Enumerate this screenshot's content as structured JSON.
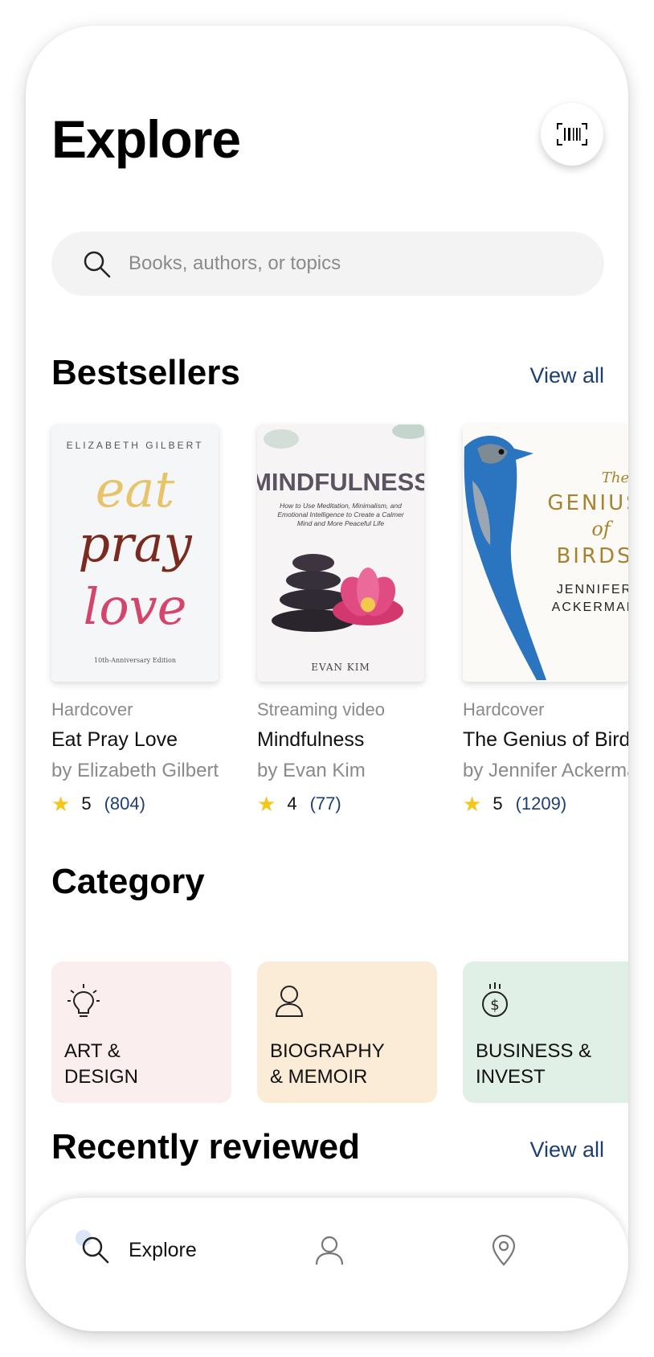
{
  "header": {
    "title": "Explore"
  },
  "search": {
    "placeholder": "Books, authors, or topics"
  },
  "bestsellers": {
    "title": "Bestsellers",
    "view_all": "View all",
    "books": [
      {
        "format": "Hardcover",
        "title": "Eat Pray Love",
        "author": "by Elizabeth Gilbert",
        "rating": "5",
        "reviews": "(804)",
        "cover": {
          "author_line": "ELIZABETH GILBERT",
          "words": [
            "eat",
            "pray",
            "love"
          ],
          "edition": "10th-Anniversary Edition"
        }
      },
      {
        "format": "Streaming video",
        "title": "Mindfulness",
        "author": "by Evan Kim",
        "rating": "4",
        "reviews": "(77)",
        "cover": {
          "title": "MINDFULNESS",
          "subtitle": "How to Use Meditation, Minimalism, and Emotional Intelligence to Create a Calmer Mind and More Peaceful Life",
          "author_line": "EVAN KIM"
        }
      },
      {
        "format": "Hardcover",
        "title": "The Genius of Birds",
        "author": "by Jennifer Ackerman",
        "rating": "5",
        "reviews": "(1209)",
        "cover": {
          "the": "The",
          "genius": "GENIUS",
          "of": "of",
          "birds": "BIRDS",
          "author_first": "JENNIFER",
          "author_last": "ACKERMAN"
        }
      }
    ]
  },
  "category": {
    "title": "Category",
    "items": [
      {
        "label": "ART &\nDESIGN",
        "icon": "lightbulb-icon",
        "color": "#fbeeee"
      },
      {
        "label": "BIOGRAPHY\n& MEMOIR",
        "icon": "person-icon",
        "color": "#fbecd7"
      },
      {
        "label": "BUSINESS &\nINVEST",
        "icon": "money-icon",
        "color": "#e0f0e6"
      }
    ]
  },
  "recently_reviewed": {
    "title": "Recently reviewed",
    "view_all": "View all"
  },
  "tabbar": {
    "explore_label": "Explore"
  },
  "colors": {
    "link": "#1d3f72",
    "star": "#f7c518",
    "search_bg": "#f3f3f3"
  }
}
